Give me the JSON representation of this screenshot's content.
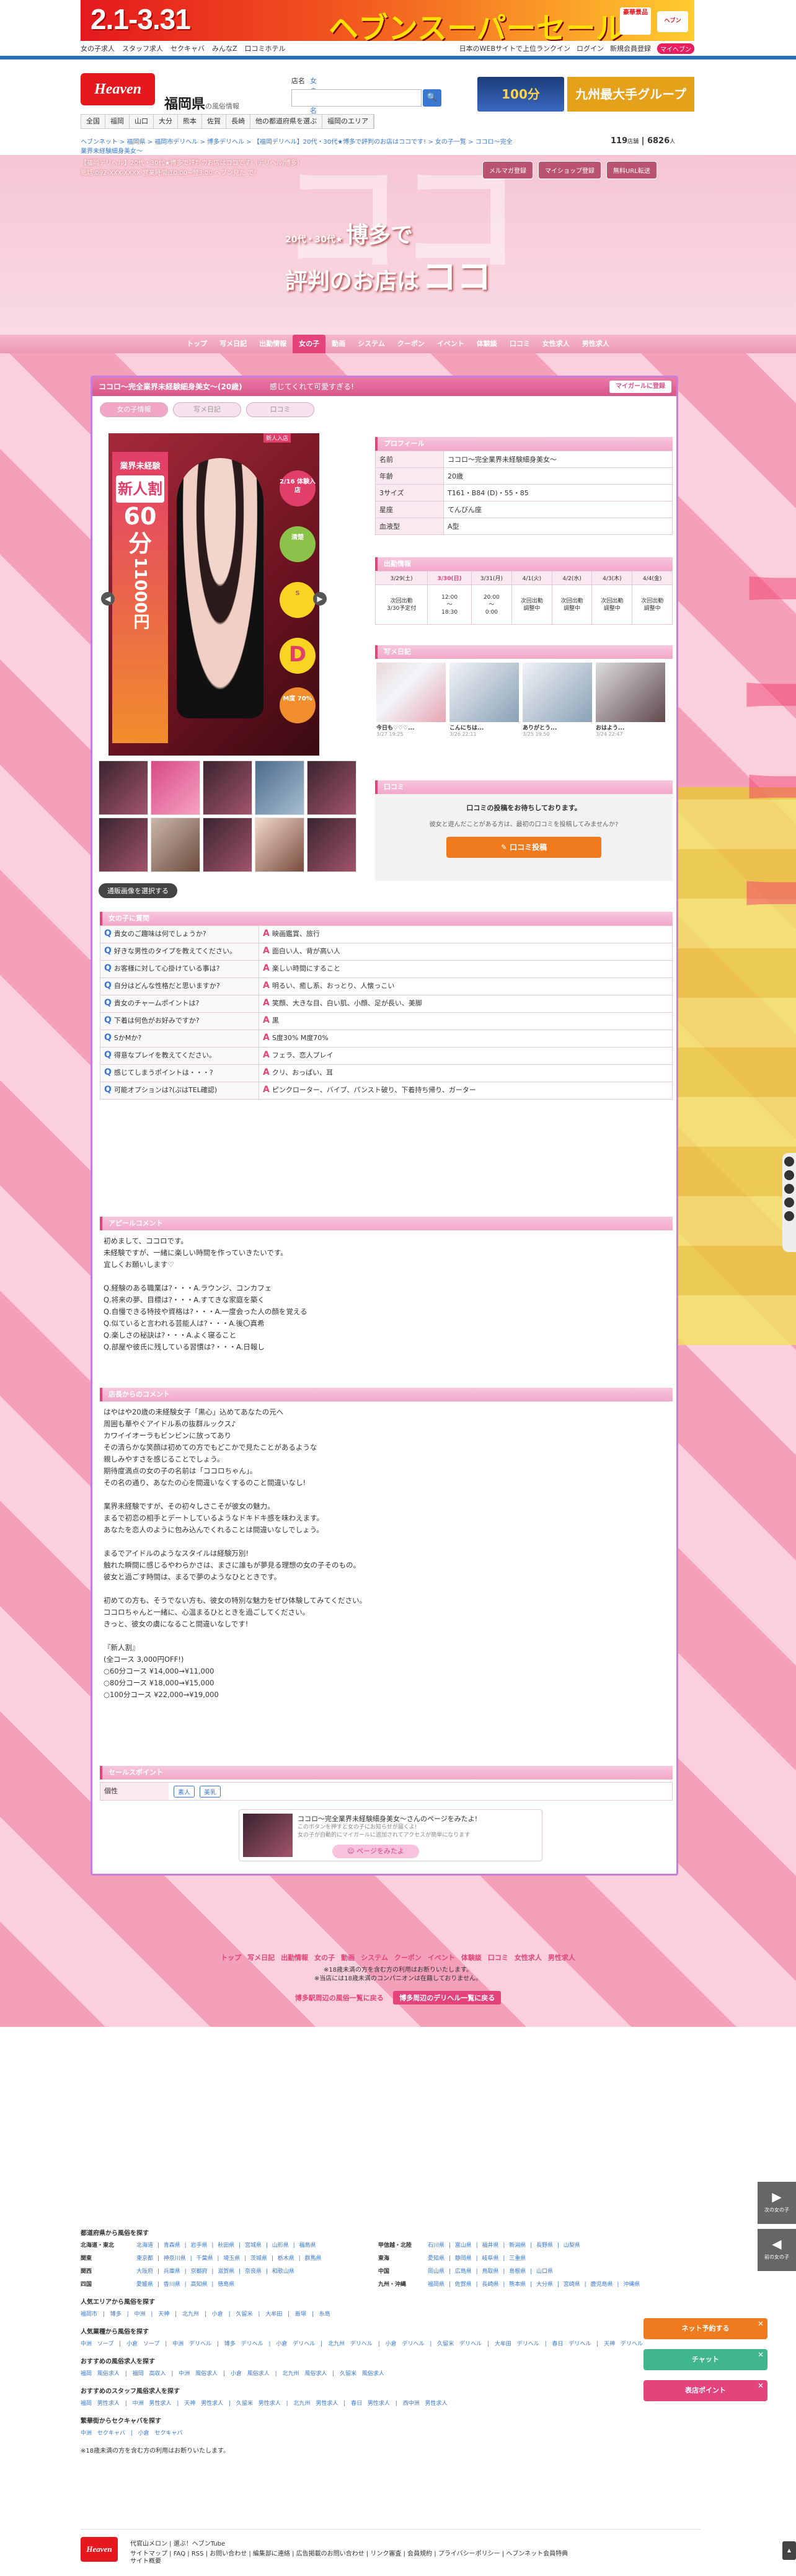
{
  "banner": {
    "dates": "2.1-3.31",
    "title": "ヘブンスーパーセール",
    "badge": "豪華景品",
    "app": "ヘブン"
  },
  "topnav": {
    "left": [
      "女の子求人",
      "スタッフ求人",
      "セクキャバ",
      "みんなZ",
      "口コミホテル"
    ],
    "right": [
      "日本のWEBサイトで上位ランクイン",
      "ログイン",
      "新規会員登録",
      "マイヘブン"
    ]
  },
  "header": {
    "logo": "Heaven",
    "region": "福岡県",
    "region_sub": "の風俗情報",
    "search_label": "店名",
    "search_tag": "女の子名",
    "search_go": "🔍",
    "ad1": "100分",
    "ad2": "九州最大手グループ",
    "areas": [
      "全国",
      "福岡",
      "山口",
      "大分",
      "熊本",
      "佐賀",
      "長崎",
      "他の都道府県を選ぶ",
      "福岡のエリア"
    ]
  },
  "crumb": "ヘブンネット > 福岡県 > 福岡市デリヘル > 博多デリヘル > 【福岡デリヘル】20代・30代★博多で評判のお店はココです! > 女の子一覧 > ココロ～完全業界未経験細身美女～",
  "counter": {
    "a": "119",
    "a_unit": "店舗",
    "b": "6826",
    "b_unit": "人"
  },
  "shop": {
    "info1": "【福岡デリヘル】20代・30代★博多で評判のお店はココです! (デリヘル/博多)",
    "info2": "電話:092-XXX-XXXX 営業時間:10:00~翌3:00 ヘブン見た で!",
    "btns": [
      "メルマガ登録",
      "マイショップ登録",
      "無料URL転送"
    ],
    "catch_s": "20代・30代★",
    "catch_l": "博多で",
    "catch_m": "評判のお店は",
    "catch_xl": "ココ",
    "nav": [
      "トップ",
      "写メ日記",
      "出勤情報",
      "女の子",
      "動画",
      "システム",
      "クーポン",
      "イベント",
      "体験談",
      "口コミ",
      "女性求人",
      "男性求人"
    ],
    "nav_active": 3
  },
  "girl": {
    "titlebar": "ココロ～完全業界未経験細身美女～(20歳)",
    "comment": "感じてくれて可愛すぎる!",
    "mybtn": "マイガールに登録",
    "tabs": [
      "女の子情報",
      "写メ日記",
      "口コミ"
    ],
    "photo": {
      "label": "業界未経験",
      "labelsub": "新人割",
      "price1": "60分",
      "price2": "11000円",
      "new": "新人入店",
      "r1": "2/16 体験入店",
      "r2": "清楚",
      "r3": "S",
      "r4": "D",
      "r5": "M度 70%"
    },
    "switch_btn": "通販画像を選択する"
  },
  "profile": {
    "title": "プロフィール",
    "rows": [
      [
        "名前",
        "ココロ～完全業界未経験細身美女～"
      ],
      [
        "年齢",
        "20歳"
      ],
      [
        "3サイズ",
        "T161・B84 (D)・55・85"
      ],
      [
        "星座",
        "てんびん座"
      ],
      [
        "血液型",
        "A型"
      ]
    ]
  },
  "schedule": {
    "title": "出勤情報",
    "days": [
      "3/29(土)",
      "3/30(日)",
      "3/31(月)",
      "4/1(火)",
      "4/2(水)",
      "4/3(木)",
      "4/4(金)"
    ],
    "today": 1,
    "cells": [
      "次回出勤\n3/30予定付",
      "12:00\n〜\n18:30",
      "20:00\n〜\n0:00",
      "次回出勤\n調整中",
      "次回出勤\n調整中",
      "次回出勤\n調整中",
      "次回出勤\n調整中"
    ]
  },
  "diary": {
    "title": "写メ日記",
    "items": [
      {
        "t": "今日も♡♡♡...",
        "d": "3/27 19:25"
      },
      {
        "t": "こんにちは...",
        "d": "3/26 22:11"
      },
      {
        "t": "ありがとう...",
        "d": "3/25 19:50"
      },
      {
        "t": "おはよう...",
        "d": "3/24 22:47"
      }
    ]
  },
  "kuchikomi": {
    "title": "口コミ",
    "m1": "口コミの投稿をお待ちしております。",
    "m2": "彼女と遊んだことがある方は、最初の口コミを投稿してみませんか?",
    "btn": "✎ 口コミ投稿"
  },
  "qa": {
    "title": "女の子に質問",
    "rows": [
      [
        "貴女のご趣味は何でしょうか?",
        "映画鑑賞、旅行"
      ],
      [
        "好きな男性のタイプを教えてください。",
        "面白い人、背が高い人"
      ],
      [
        "お客様に対して心掛けている事は?",
        "楽しい時間にすること"
      ],
      [
        "自分はどんな性格だと思いますか?",
        "明るい、癒し系、おっとり、人懐っこい"
      ],
      [
        "貴女のチャームポイントは?",
        "笑顔、大きな目、白い肌、小顔、足が長い、美脚"
      ],
      [
        "下着は何色がお好みですか?",
        "黒"
      ],
      [
        "SかMか?",
        "S度30% M度70%"
      ],
      [
        "得意なプレイを教えてください。",
        "フェラ、恋人プレイ"
      ],
      [
        "感じてしまうポイントは・・・?",
        "クリ、おっぱい、耳"
      ],
      [
        "可能オプションは?(ぷはTEL確認)",
        "ピンクローター、バイブ、パンスト破り、下着持ち帰り、ガーター"
      ]
    ]
  },
  "appeal": {
    "title": "アピールコメント",
    "text": "初めまして、ココロです。\n未経験ですが、一緒に楽しい時間を作っていきたいです。\n宜しくお願いします♡\n\nQ.経験のある職業は?・・・A.ラウンジ、コンカフェ\nQ.将来の夢、目標は?・・・A.すてきな家庭を築く\nQ.自慢できる特技や資格は?・・・A.一度会った人の顔を覚える\nQ.似ていると言われる芸能人は?・・・A.後〇真希\nQ.楽しさの秘訣は?・・・A.よく寝ること\nQ.部屋や彼氏に残している習慣は?・・・A.日報し"
  },
  "shopcomment": {
    "title": "店長からのコメント",
    "text": "はやはや20歳の未経験女子「黒心」込めてあなたの元へ\n周囲も華やぐアイドル系の抜群ルックス♪\nカワイイオーラもビンビンに放ってあり\nその清らかな笑顔は初めての方でもどこかで見たことがあるような\n親しみやすさを感じることでしょう。\n期待度満点の女の子の名前は「ココロちゃん」。\nその名の通り、あなたの心を間違いなくするのこと間違いなし!\n\n業界未経験ですが、その初々しさこそが彼女の魅力。\nまるで初恋の相手とデートしているようなドキドキ感を味わえます。\nあなたを恋人のように包み込んでくれることは間違いなしでしょう。\n\nまるでアイドルのようなスタイルは経験万別!\n触れた瞬間に感じるやわらかさは、まさに誰もが夢見る理想の女の子そのもの。\n彼女と過ごす時間は、まるで夢のようなひとときです。\n\n初めての方も、そうでない方も、彼女の特別な魅力をぜひ体験してみてください。\nココロちゃんと一緒に、心温まるひとときを過ごしてください。\nきっと、彼女の虜になること間違いなしです!\n\n『新人割』\n(全コース 3,000円OFF!)\n○60分コース ¥14,000→¥11,000\n○80分コース ¥18,000→¥15,000\n○100分コース ¥22,000→¥19,000"
  },
  "sales": {
    "title": "セールスポイント",
    "key": "個性",
    "tags": [
      "素人",
      "美乳"
    ]
  },
  "promo": {
    "title": "ココロ～完全業界未経験細身美女～さんのページをみたよ!",
    "sub": "このボタンを押すと女の子にお知らせが届くよ!\n女の子が自動的にマイガールに追加されてアクセスが簡単になります",
    "btn": "☺ ページをみたよ"
  },
  "foot1": {
    "links": [
      "トップ",
      "写メ日記",
      "出勤情報",
      "女の子",
      "動画",
      "システム",
      "クーポン",
      "イベント",
      "体験談",
      "口コミ",
      "女性求人",
      "男性求人"
    ],
    "note1": "※18歳未満の方を含む方の利用はお断りいたします。",
    "note2": "※当店には18歳未満のコンパニオンは在籍しておりません。",
    "b1": "博多駅周辺の風俗一覧に戻る",
    "b2": "博多周辺のデリヘル一覧に戻る"
  },
  "sitemap": {
    "h1": "都道府県から風俗を探す",
    "regions": [
      [
        "北海道・東北",
        "北海道 | 青森県 | 岩手県 | 秋田県 | 宮城県 | 山形県 | 福島県",
        "甲信越・北陸",
        "石川県 | 富山県 | 福井県 | 新潟県 | 長野県 | 山梨県"
      ],
      [
        "関東",
        "東京都 | 神奈川県 | 千葉県 | 埼玉県 | 茨城県 | 栃木県 | 群馬県",
        "東海",
        "愛知県 | 静岡県 | 岐阜県 | 三重県"
      ],
      [
        "関西",
        "大阪府 | 兵庫県 | 京都府 | 滋賀県 | 奈良県 | 和歌山県",
        "中国",
        "岡山県 | 広島県 | 鳥取県 | 島根県 | 山口県"
      ],
      [
        "四国",
        "愛媛県 | 香川県 | 高知県 | 徳島県",
        "九州・沖縄",
        "福岡県 | 佐賀県 | 長崎県 | 熊本県 | 大分県 | 宮崎県 | 鹿児島県 | 沖縄県"
      ]
    ],
    "h2": "人気エリアから風俗を探す",
    "l2": "福岡市 | 博多 | 中洲 | 天神 | 北九州 | 小倉 | 久留米 | 大牟田 | 飯塚 | 糸島",
    "h3": "人気業種から風俗を探す",
    "l3": "中洲 ソープ | 小倉 ソープ | 中洲 デリヘル | 博多 デリヘル | 小倉 デリヘル | 北九州 デリヘル | 小倉 デリヘル | 久留米 デリヘル | 大牟田 デリヘル | 春日 デリヘル | 天神 デリヘル",
    "h4": "おすすめの風俗求人を探す",
    "l4": "福岡 風俗求人 | 福岡 高収入 | 中洲 風俗求人 | 小倉 風俗求人 | 北九州 風俗求人 | 久留米 風俗求人",
    "h5": "おすすめのスタッフ風俗求人を探す",
    "l5": "福岡 男性求人 | 中洲 男性求人 | 天神 男性求人 | 久留米 男性求人 | 北九州 男性求人 | 春日 男性求人 | 西中洲 男性求人",
    "h6": "繁華街からセクキャバを探す",
    "l6": "中洲 セクキャバ | 小倉 セクキャバ",
    "note": "※18歳未満の方を含む方の利用はお断りいたします。"
  },
  "footer": {
    "logo": "Heaven",
    "l1": "代官山メロン | 選ぶ！ヘブンTube",
    "l2": "サイトマップ | FAQ | RSS | お問い合わせ | 編集部に連絡 | 広告掲載のお問い合わせ | リンク審査 | 会員規約 | プライバシーポリシー | ヘブンネット会員特典",
    "l3": "サイト概要"
  },
  "side": {
    "next": "次の女の子",
    "prev": "前の女の子",
    "p1": "ネット予約する",
    "p2": "チャット",
    "p3": "表店ポイント"
  },
  "colors": {
    "accent": "#e4437c",
    "pink": "#f2a6c6",
    "purple": "#c87cdb"
  }
}
